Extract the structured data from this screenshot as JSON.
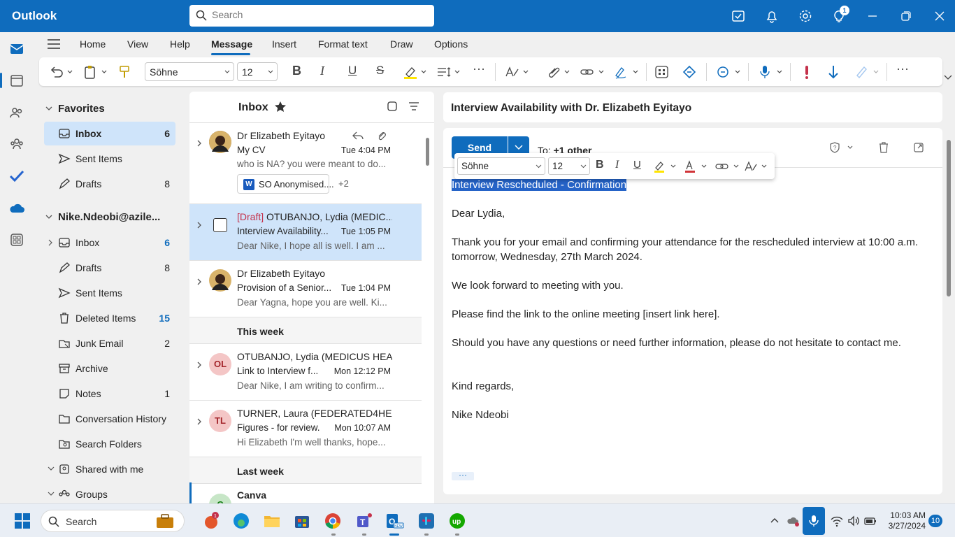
{
  "app": {
    "title": "Outlook",
    "help_badge": "1"
  },
  "search": {
    "placeholder": "Search"
  },
  "menu": {
    "tabs": [
      "Home",
      "View",
      "Help",
      "Message",
      "Insert",
      "Format text",
      "Draw",
      "Options"
    ],
    "active": "Message"
  },
  "ribbon": {
    "font": "Söhne",
    "size": "12"
  },
  "folders": {
    "favorites_label": "Favorites",
    "favorites": [
      {
        "name": "Inbox",
        "count": "6"
      },
      {
        "name": "Sent Items",
        "count": ""
      },
      {
        "name": "Drafts",
        "count": "8"
      }
    ],
    "account_label": "Nike.Ndeobi@azile...",
    "account": [
      {
        "name": "Inbox",
        "count": "6"
      },
      {
        "name": "Drafts",
        "count": "8"
      },
      {
        "name": "Sent Items",
        "count": ""
      },
      {
        "name": "Deleted Items",
        "count": "15"
      },
      {
        "name": "Junk Email",
        "count": "2"
      },
      {
        "name": "Archive",
        "count": ""
      },
      {
        "name": "Notes",
        "count": "1"
      },
      {
        "name": "Conversation History",
        "count": ""
      },
      {
        "name": "Search Folders",
        "count": ""
      },
      {
        "name": "Shared with me",
        "count": ""
      },
      {
        "name": "Groups",
        "count": ""
      }
    ]
  },
  "list": {
    "title": "Inbox",
    "messages": [
      {
        "from": "Dr Elizabeth Eyitayo",
        "subject": "My CV",
        "time": "Tue 4:04 PM",
        "preview": "who is NA? you were meant to do...",
        "attachment": "SO Anonymised....",
        "more": "+2"
      },
      {
        "draft_tag": "[Draft]",
        "from": "OTUBANJO, Lydia (MEDIC...",
        "subject": "Interview Availability...",
        "time": "Tue 1:05 PM",
        "preview": "Dear Nike, I hope all is well. I am ..."
      },
      {
        "from": "Dr Elizabeth Eyitayo",
        "subject": "Provision of a Senior...",
        "time": "Tue 1:04 PM",
        "preview": "Dear Yagna, hope you are well. Ki..."
      },
      {
        "initials": "OL",
        "from": "OTUBANJO, Lydia (MEDICUS HEA...",
        "subject": "Link to Interview f...",
        "time": "Mon 12:12 PM",
        "preview": "Dear Nike, I am writing to confirm..."
      },
      {
        "initials": "TL",
        "from": "TURNER, Laura (FEDERATED4HEA...",
        "subject": "Figures - for review.",
        "time": "Mon 10:07 AM",
        "preview": "Hi Elizabeth I'm well thanks, hope..."
      },
      {
        "initials": "C",
        "from": "Canva"
      }
    ],
    "group_this_week": "This week",
    "group_last_week": "Last week"
  },
  "reading": {
    "subject": "Interview Availability with Dr. Elizabeth Eyitayo",
    "send": "Send",
    "to_prefix": "To:",
    "to_value": "+1 other",
    "toolbar_font": "Söhne",
    "toolbar_size": "12",
    "body": {
      "heading": "Interview Rescheduled - Confirmation",
      "greeting": "Dear Lydia,",
      "p1": "Thank you for your email and confirming your attendance for the rescheduled interview at 10:00 a.m. tomorrow, Wednesday, 27th March 2024.",
      "p2": "We look forward to meeting with you.",
      "p3": "Please find the link to the online meeting [insert link here].",
      "p4": "Should you have any questions or need further information, please do not hesitate to contact me.",
      "closing": "Kind regards,",
      "signature": "Nike Ndeobi"
    },
    "more": "···"
  },
  "taskbar": {
    "search": "Search",
    "time": "10:03 AM",
    "date": "3/27/2024",
    "notifications": "10",
    "store_badge": "1",
    "new_badge": "NEW"
  }
}
